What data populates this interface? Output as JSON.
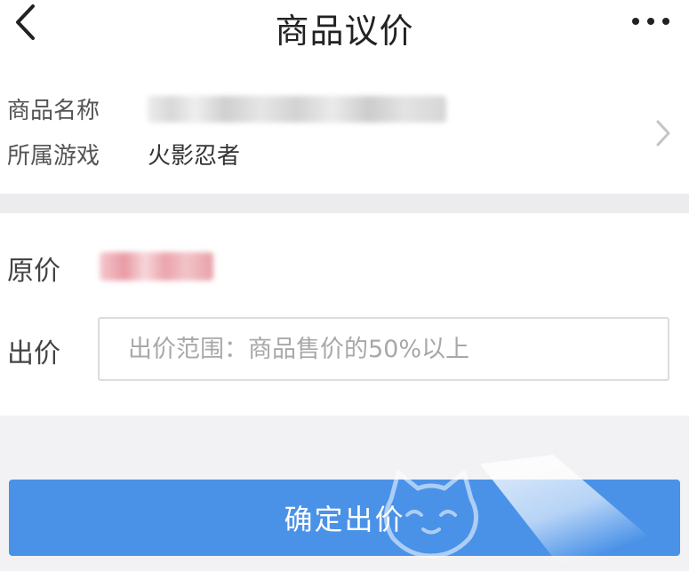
{
  "header": {
    "title": "商品议价",
    "back_icon": "chevron-left-icon",
    "more_icon": "more-horizontal-icon"
  },
  "product": {
    "name_label": "商品名称",
    "game_label": "所属游戏",
    "game_value": "火影忍者",
    "chevron_icon": "chevron-right-icon"
  },
  "price": {
    "original_label": "原价",
    "offer_label": "出价",
    "offer_placeholder": "出价范围：商品售价的50%以上",
    "offer_value": ""
  },
  "actions": {
    "confirm_label": "确定出价"
  },
  "colors": {
    "primary": "#4a92e8",
    "background": "#f2f2f4",
    "card": "#ffffff"
  }
}
